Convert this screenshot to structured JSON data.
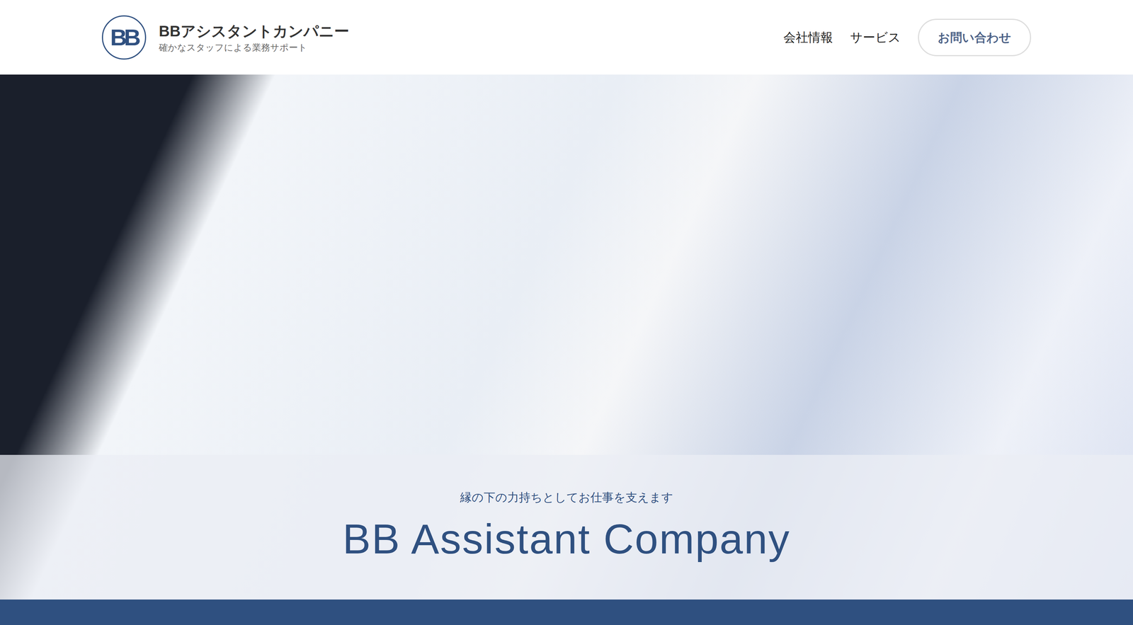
{
  "header": {
    "logo": "BB",
    "title": "BBアシスタントカンパニー",
    "subtitle": "確かなスタッフによる業務サポート",
    "nav": [
      "会社情報",
      "サービス"
    ],
    "cta": "お問い合わせ"
  },
  "hero": {
    "tagline": "縁の下の力持ちとしてお仕事を支えます",
    "heading": "BB Assistant Company"
  }
}
